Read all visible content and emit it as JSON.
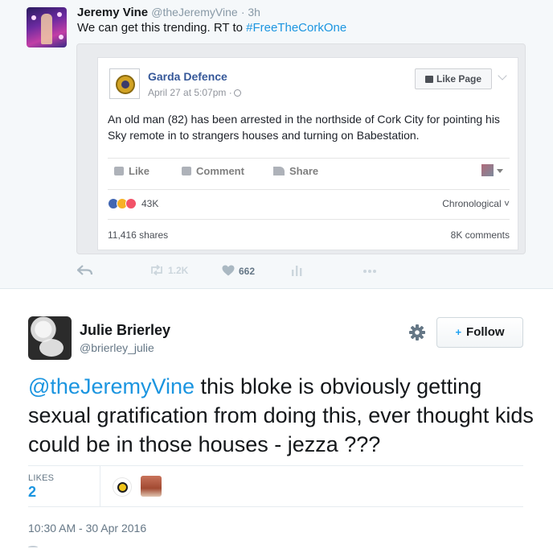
{
  "parent_tweet": {
    "name": "Jeremy Vine",
    "handle": "@theJeremyVine",
    "time": "· 3h",
    "text_prefix": "We can get this trending. RT to ",
    "hashtag": "#FreeTheCorkOne",
    "actions": {
      "reply_icon": "reply-icon",
      "retweet_count": "1.2K",
      "like_count": "662",
      "analytics_icon": "analytics-icon",
      "more_icon": "more-icon"
    }
  },
  "embedded_post": {
    "page_name": "Garda Defence",
    "date": "April 27 at 5:07pm ·",
    "like_page_label": "Like Page",
    "body": "An old man (82) has been arrested in the northside of Cork City for pointing his Sky remote in to strangers houses and turning on Babestation.",
    "actions": [
      "Like",
      "Comment",
      "Share"
    ],
    "reaction_count": "43K",
    "sort_label": "Chronological",
    "shares": "11,416 shares",
    "comments": "8K comments"
  },
  "reply_tweet": {
    "name": "Julie Brierley",
    "handle": "@brierley_julie",
    "follow_label": "Follow",
    "mention": "@theJeremyVine",
    "text": " this bloke is obviously getting sexual gratification from doing this, ever thought kids could be in those houses - jezza ???",
    "likes_label": "LIKES",
    "likes_count": "2",
    "timestamp": "10:30 AM - 30 Apr 2016"
  },
  "colors": {
    "link_blue": "#1b95e0",
    "facebook_blue": "#365899",
    "muted_gray": "#657786",
    "parent_background": "#f5f8fa"
  }
}
